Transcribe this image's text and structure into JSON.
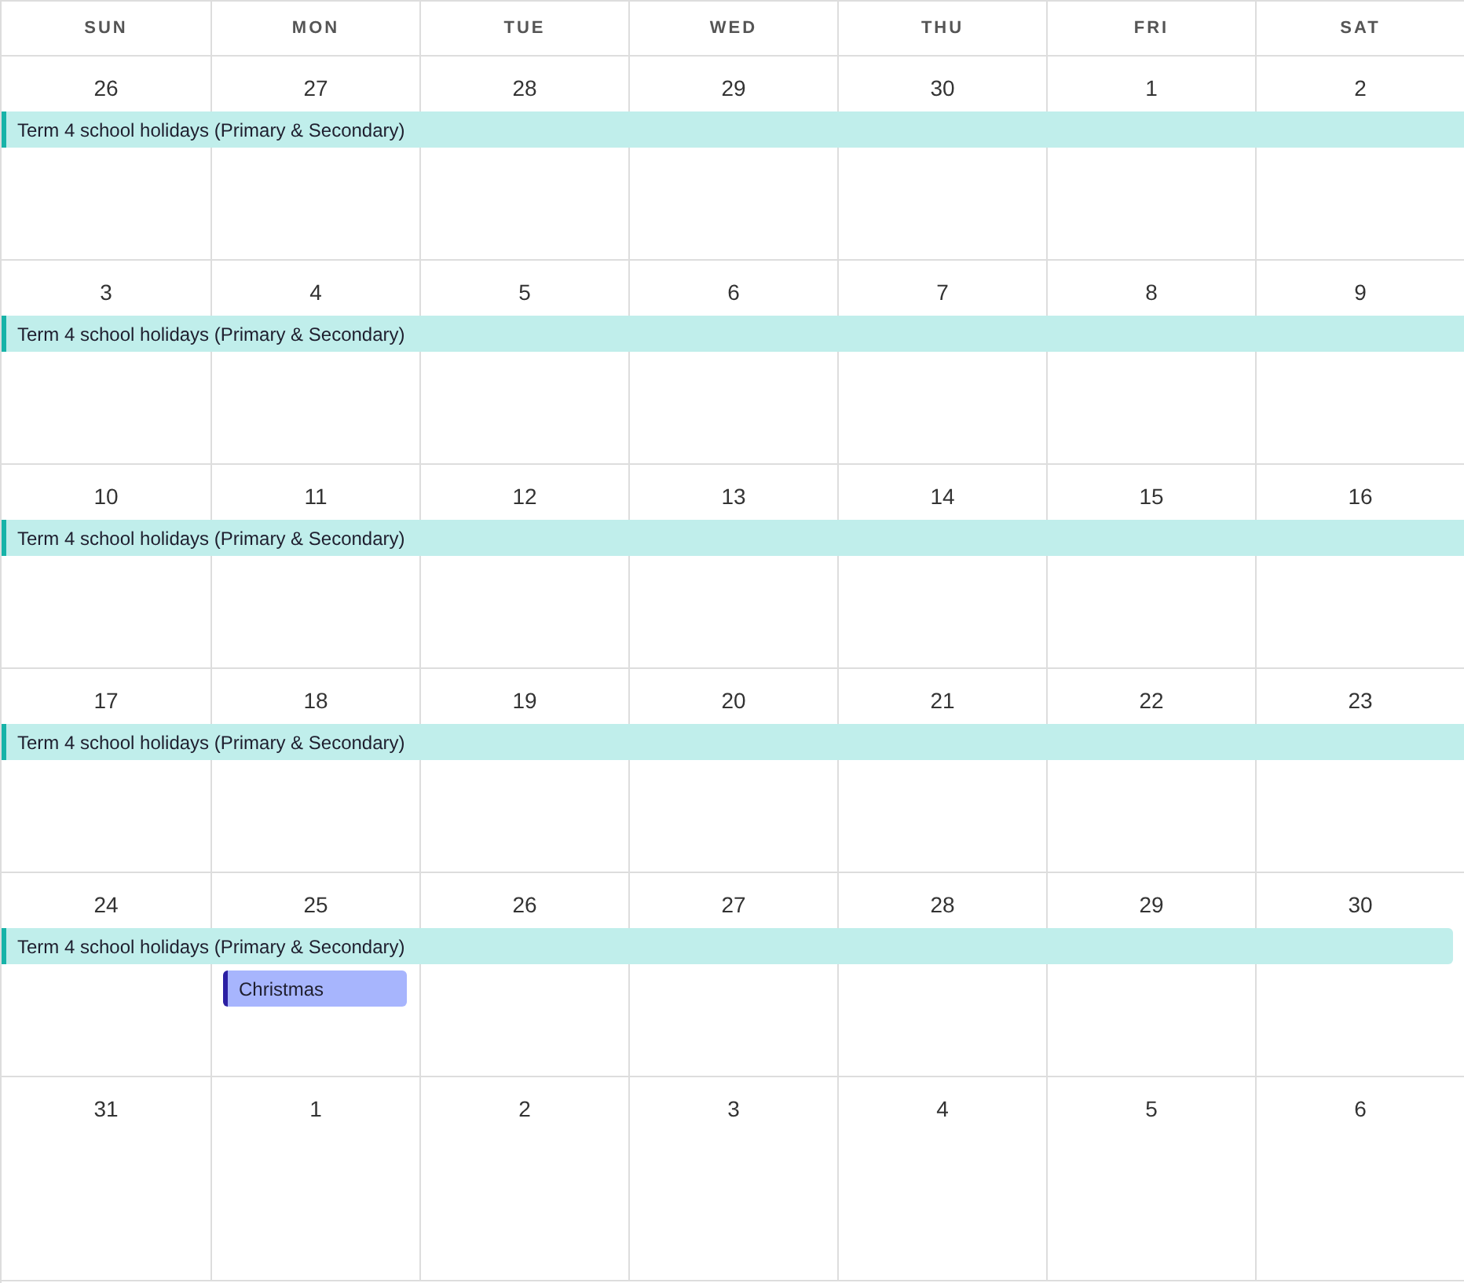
{
  "weekdays": [
    "SUN",
    "MON",
    "TUE",
    "WED",
    "THU",
    "FRI",
    "SAT"
  ],
  "weeks": [
    {
      "days": [
        {
          "date": "26",
          "events": [
            {
              "title": "Term 4 school holidays (Primary & Secondary)",
              "kind": "span",
              "color": "#17b3a8",
              "continues": true
            }
          ]
        },
        {
          "date": "27"
        },
        {
          "date": "28"
        },
        {
          "date": "29"
        },
        {
          "date": "30"
        },
        {
          "date": "1"
        },
        {
          "date": "2"
        }
      ]
    },
    {
      "days": [
        {
          "date": "3",
          "events": [
            {
              "title": "Term 4 school holidays (Primary & Secondary)",
              "kind": "span",
              "color": "#17b3a8",
              "continues": true
            }
          ]
        },
        {
          "date": "4"
        },
        {
          "date": "5"
        },
        {
          "date": "6"
        },
        {
          "date": "7"
        },
        {
          "date": "8"
        },
        {
          "date": "9"
        }
      ]
    },
    {
      "days": [
        {
          "date": "10",
          "events": [
            {
              "title": "Term 4 school holidays (Primary & Secondary)",
              "kind": "span",
              "color": "#17b3a8",
              "continues": true
            }
          ]
        },
        {
          "date": "11"
        },
        {
          "date": "12"
        },
        {
          "date": "13"
        },
        {
          "date": "14"
        },
        {
          "date": "15"
        },
        {
          "date": "16"
        }
      ]
    },
    {
      "days": [
        {
          "date": "17",
          "events": [
            {
              "title": "Term 4 school holidays (Primary & Secondary)",
              "kind": "span",
              "color": "#17b3a8",
              "continues": true
            }
          ]
        },
        {
          "date": "18"
        },
        {
          "date": "19"
        },
        {
          "date": "20"
        },
        {
          "date": "21"
        },
        {
          "date": "22"
        },
        {
          "date": "23"
        }
      ]
    },
    {
      "days": [
        {
          "date": "24",
          "events": [
            {
              "title": "Term 4 school holidays (Primary & Secondary)",
              "kind": "span",
              "color": "#17b3a8",
              "continues": false
            }
          ]
        },
        {
          "date": "25",
          "events": [
            {
              "title": "Christmas",
              "kind": "single",
              "color": "#2b1fa3"
            }
          ]
        },
        {
          "date": "26"
        },
        {
          "date": "27"
        },
        {
          "date": "28"
        },
        {
          "date": "29"
        },
        {
          "date": "30"
        }
      ]
    },
    {
      "days": [
        {
          "date": "31"
        },
        {
          "date": "1"
        },
        {
          "date": "2"
        },
        {
          "date": "3"
        },
        {
          "date": "4"
        },
        {
          "date": "5"
        },
        {
          "date": "6"
        }
      ]
    }
  ]
}
